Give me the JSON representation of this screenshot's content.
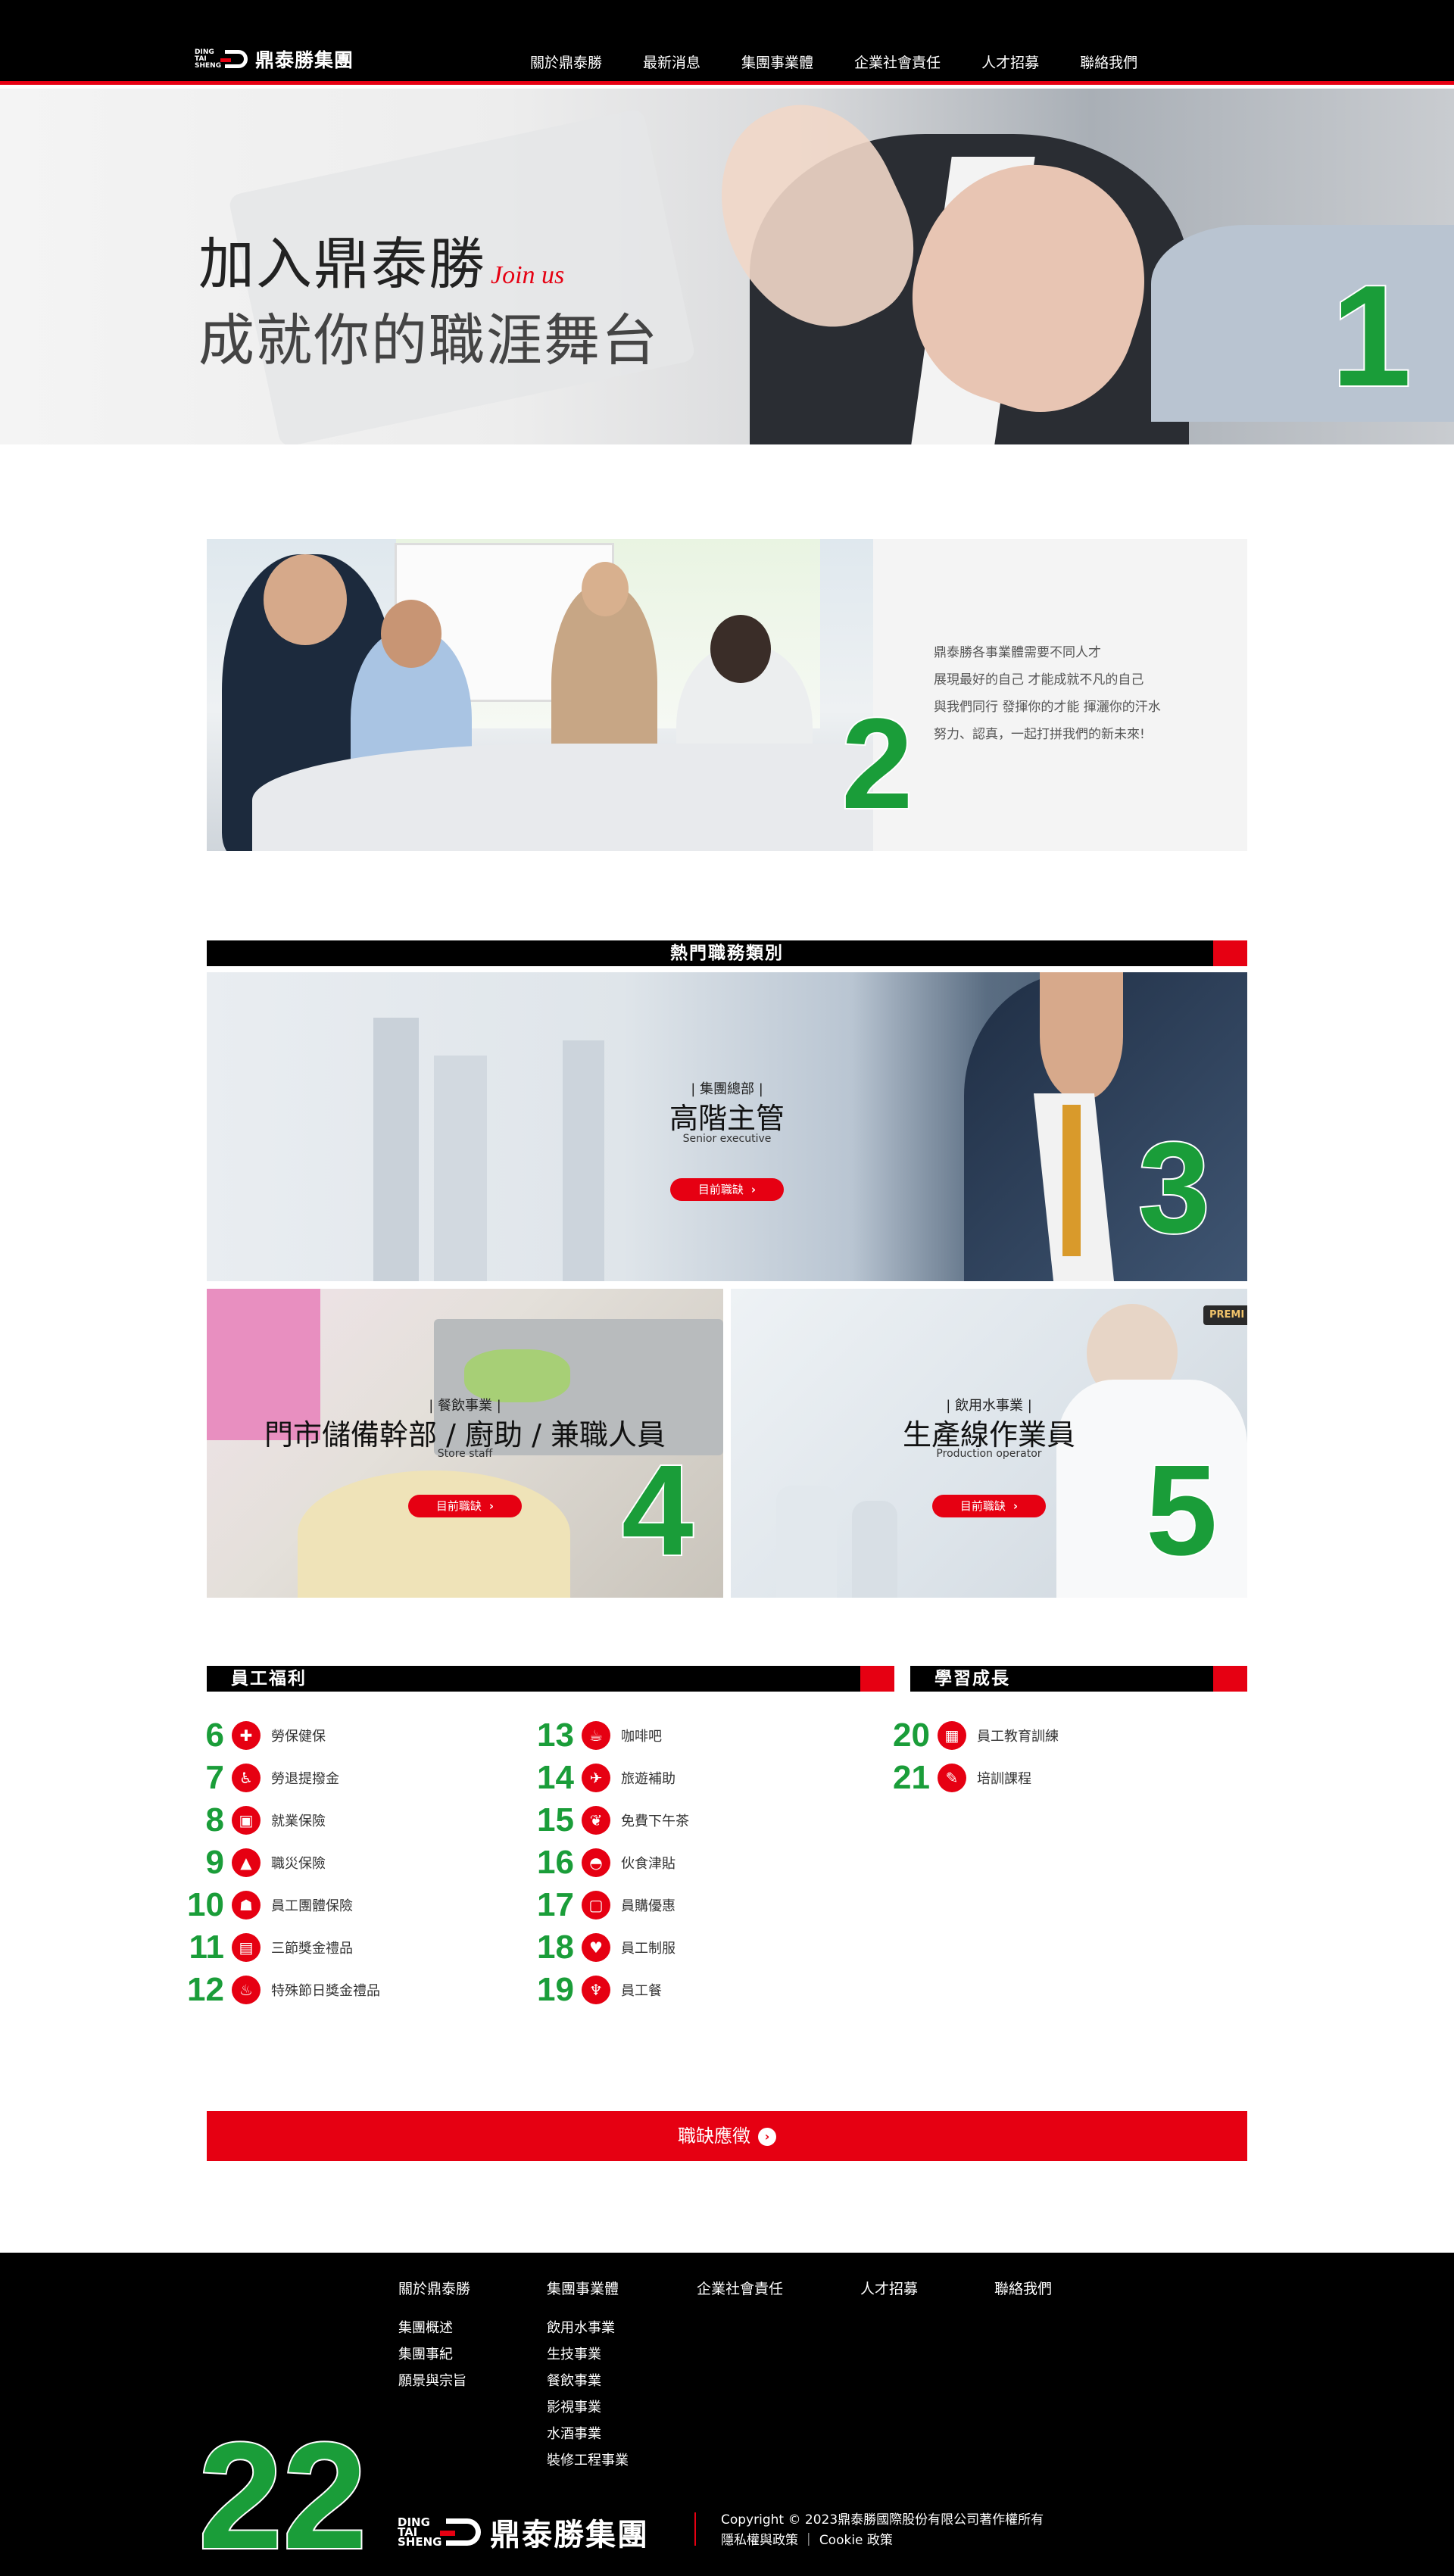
{
  "header": {
    "logo_en": "DING TAI SHENG",
    "logo_cn": "鼎泰勝集團",
    "nav": [
      "關於鼎泰勝",
      "最新消息",
      "集團事業體",
      "企業社會責任",
      "人才招募",
      "聯絡我們"
    ]
  },
  "hero": {
    "line1": "加入鼎泰勝",
    "join": "Join us",
    "line2": "成就你的職涯舞台",
    "marker": "1"
  },
  "intro": {
    "lines": [
      "鼎泰勝各事業體需要不同人才",
      "展現最好的自己 才能成就不凡的自己",
      "與我們同行 發揮你的才能 揮灑你的汗水",
      "努力、認真，一起打拼我們的新未來!"
    ],
    "marker": "2"
  },
  "jobs": {
    "section_title": "熱門職務類別",
    "button_label": "目前職缺",
    "items": [
      {
        "dept": "| 集團總部 |",
        "title": "高階主管",
        "en": "Senior executive",
        "marker": "3"
      },
      {
        "dept": "| 餐飲事業 |",
        "title": "門市儲備幹部 / 廚助 / 兼職人員",
        "en": "Store staff",
        "marker": "4"
      },
      {
        "dept": "| 飲用水事業 |",
        "title": "生產線作業員",
        "en": "Production operator",
        "marker": "5",
        "badge": "PREMI"
      }
    ]
  },
  "benefits": {
    "title": "員工福利",
    "col1": [
      {
        "n": "6",
        "label": "勞保健保",
        "icon": "health-insurance-icon",
        "glyph": "✚"
      },
      {
        "n": "7",
        "label": "勞退提撥金",
        "icon": "pension-icon",
        "glyph": "♿"
      },
      {
        "n": "8",
        "label": "就業保險",
        "icon": "briefcase-icon",
        "glyph": "▣"
      },
      {
        "n": "9",
        "label": "職災保險",
        "icon": "factory-icon",
        "glyph": "▲"
      },
      {
        "n": "10",
        "label": "員工團體保險",
        "icon": "group-icon",
        "glyph": "☗"
      },
      {
        "n": "11",
        "label": "三節獎金禮品",
        "icon": "bonus-icon",
        "glyph": "▤"
      },
      {
        "n": "12",
        "label": "特殊節日獎金禮品",
        "icon": "cake-icon",
        "glyph": "♨"
      }
    ],
    "col2": [
      {
        "n": "13",
        "label": "咖啡吧",
        "icon": "coffee-icon",
        "glyph": "☕"
      },
      {
        "n": "14",
        "label": "旅遊補助",
        "icon": "plane-icon",
        "glyph": "✈"
      },
      {
        "n": "15",
        "label": "免費下午茶",
        "icon": "tea-icon",
        "glyph": "❦"
      },
      {
        "n": "16",
        "label": "伙食津貼",
        "icon": "meal-icon",
        "glyph": "◓"
      },
      {
        "n": "17",
        "label": "員購優惠",
        "icon": "shopping-bag-icon",
        "glyph": "▢"
      },
      {
        "n": "18",
        "label": "員工制服",
        "icon": "uniform-icon",
        "glyph": "♥"
      },
      {
        "n": "19",
        "label": "員工餐",
        "icon": "utensils-icon",
        "glyph": "♆"
      }
    ]
  },
  "learning": {
    "title": "學習成長",
    "items": [
      {
        "n": "20",
        "label": "員工教育訓練",
        "icon": "training-icon",
        "glyph": "▦"
      },
      {
        "n": "21",
        "label": "培訓課程",
        "icon": "course-icon",
        "glyph": "✎"
      }
    ]
  },
  "apply": {
    "label": "職缺應徵"
  },
  "footer": {
    "cols": [
      {
        "head": "關於鼎泰勝",
        "links": [
          "集團概述",
          "集團事紀",
          "願景與宗旨"
        ]
      },
      {
        "head": "集團事業體",
        "links": [
          "飲用水事業",
          "生技事業",
          "餐飲事業",
          "影視事業",
          "水酒事業",
          "裝修工程事業"
        ]
      },
      {
        "head": "企業社會責任",
        "links": []
      },
      {
        "head": "人才招募",
        "links": []
      },
      {
        "head": "聯絡我們",
        "links": []
      }
    ],
    "logo_en": "DING TAI SHENG",
    "logo_cn": "鼎泰勝集團",
    "copyright": "Copyright © 2023鼎泰勝國際股份有限公司著作權所有",
    "privacy": "隱私權與政策",
    "cookie": "Cookie 政策",
    "marker": "22"
  },
  "colors": {
    "brand_red": "#e60012",
    "marker_green": "#1a9d39",
    "header_bg": "#000000"
  }
}
